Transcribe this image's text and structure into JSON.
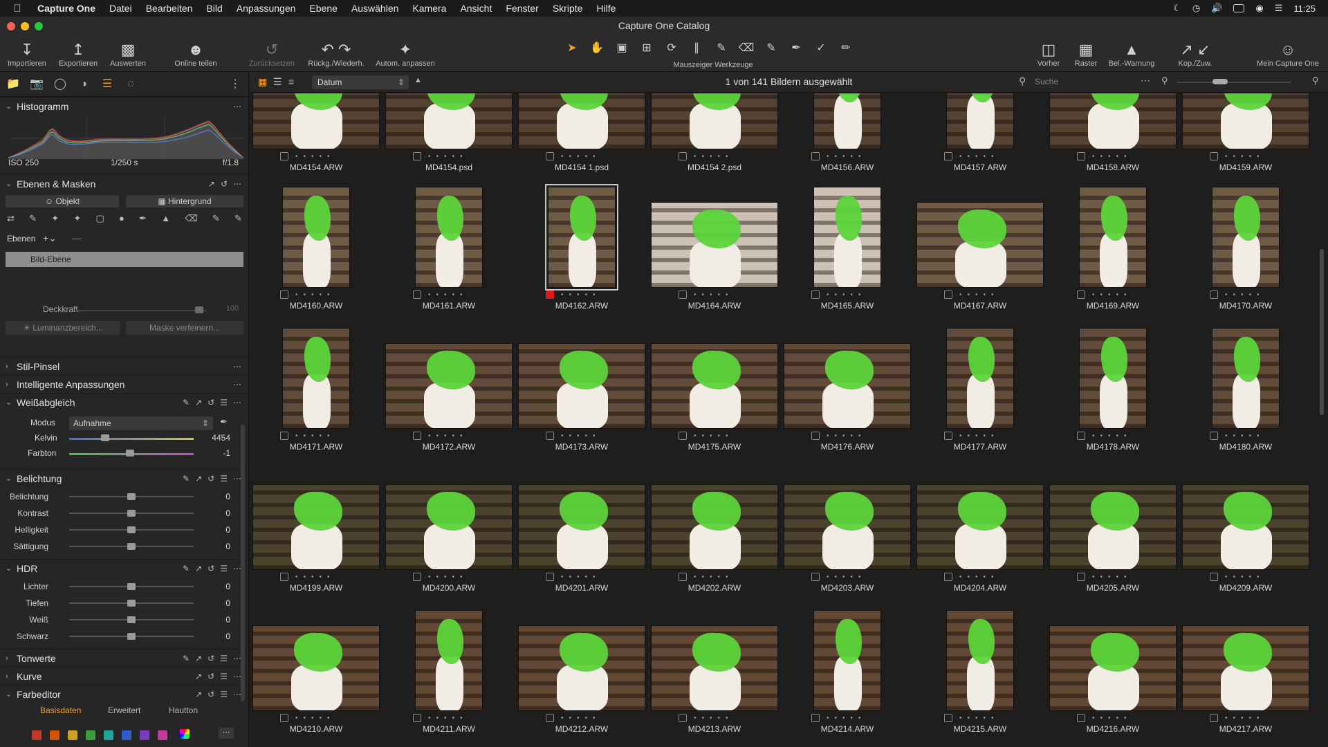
{
  "menubar": {
    "app": "Capture One",
    "items": [
      "Datei",
      "Bearbeiten",
      "Bild",
      "Anpassungen",
      "Ebene",
      "Auswählen",
      "Kamera",
      "Ansicht",
      "Fenster",
      "Skripte",
      "Hilfe"
    ],
    "clock": "11:25"
  },
  "window": {
    "title": "Capture One Catalog"
  },
  "toolbar": {
    "import": "Importieren",
    "export": "Exportieren",
    "evaluate": "Auswerten",
    "share": "Online teilen",
    "reset": "Zurücksetzen",
    "undo_redo": "Rückg./Wiederh.",
    "auto_adjust": "Autom. anpassen",
    "cursor_tools": "Mauszeiger Werkzeuge",
    "before": "Vorher",
    "grid": "Raster",
    "exposure_warning": "Bel.-Warnung",
    "copy_apply": "Kop./Zuw.",
    "my_capture_one": "Mein Capture One"
  },
  "browser": {
    "sort": "Datum",
    "selection": "1 von 141 Bildern ausgewählt",
    "search_placeholder": "Suche"
  },
  "panel": {
    "histogram": {
      "title": "Histogramm",
      "iso": "ISO 250",
      "shutter": "1/250 s",
      "aperture": "f/1.8"
    },
    "layers": {
      "title": "Ebenen & Masken",
      "object": "Objekt",
      "background": "Hintergrund",
      "layers_label": "Ebenen",
      "layer_name": "Bild-Ebene",
      "opacity_label": "Deckkraft",
      "opacity_value": "100",
      "luminance": "Luminanzbereich...",
      "refine": "Maske verfeinern..."
    },
    "style_brush": "Stil-Pinsel",
    "smart_adjust": "Intelligente Anpassungen",
    "wb": {
      "title": "Weißabgleich",
      "mode_label": "Modus",
      "mode_value": "Aufnahme",
      "kelvin_label": "Kelvin",
      "kelvin_value": "4454",
      "tint_label": "Farbton",
      "tint_value": "-1"
    },
    "exposure": {
      "title": "Belichtung",
      "rows": [
        {
          "label": "Belichtung",
          "value": "0"
        },
        {
          "label": "Kontrast",
          "value": "0"
        },
        {
          "label": "Helligkeit",
          "value": "0"
        },
        {
          "label": "Sättigung",
          "value": "0"
        }
      ]
    },
    "hdr": {
      "title": "HDR",
      "rows": [
        {
          "label": "Lichter",
          "value": "0"
        },
        {
          "label": "Tiefen",
          "value": "0"
        },
        {
          "label": "Weiß",
          "value": "0"
        },
        {
          "label": "Schwarz",
          "value": "0"
        }
      ]
    },
    "levels": "Tonwerte",
    "curve": "Kurve",
    "color_editor": {
      "title": "Farbeditor",
      "tab_basic": "Basisdaten",
      "tab_advanced": "Erweitert",
      "tab_skin": "Hautton"
    },
    "swatches": [
      "#c0392b",
      "#d35400",
      "#c9a227",
      "#3a9d3a",
      "#1fa59a",
      "#2e5fc9",
      "#7a3bbf",
      "#c23b9b"
    ]
  },
  "thumbnails": [
    "MD4154.ARW",
    "MD4154.psd",
    "MD4154 1.psd",
    "MD4154 2.psd",
    "MD4156.ARW",
    "MD4157.ARW",
    "MD4158.ARW",
    "MD4159.ARW",
    "MD4160.ARW",
    "MD4161.ARW",
    "MD4162.ARW",
    "MD4164.ARW",
    "MD4165.ARW",
    "MD4167.ARW",
    "MD4169.ARW",
    "MD4170.ARW",
    "MD4171.ARW",
    "MD4172.ARW",
    "MD4173.ARW",
    "MD4175.ARW",
    "MD4176.ARW",
    "MD4177.ARW",
    "MD4178.ARW",
    "MD4180.ARW",
    "MD4199.ARW",
    "MD4200.ARW",
    "MD4201.ARW",
    "MD4202.ARW",
    "MD4203.ARW",
    "MD4204.ARW",
    "MD4205.ARW",
    "MD4209.ARW",
    "MD4210.ARW",
    "MD4211.ARW",
    "MD4212.ARW",
    "MD4213.ARW",
    "MD4214.ARW",
    "MD4215.ARW",
    "MD4216.ARW",
    "MD4217.ARW"
  ],
  "selected_thumbnail": "MD4162.ARW"
}
